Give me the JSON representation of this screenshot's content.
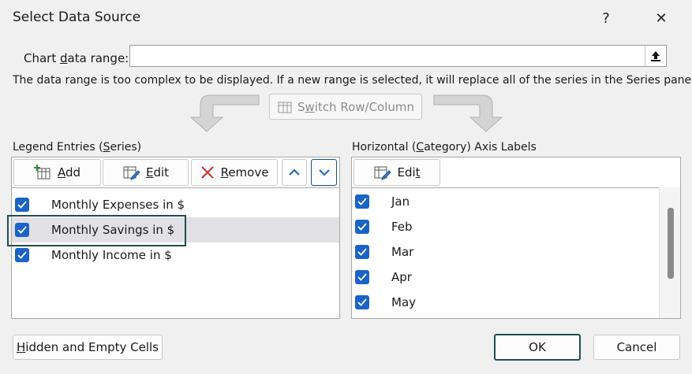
{
  "dialog": {
    "title": "Select Data Source",
    "help_label": "?",
    "close_label": "✕"
  },
  "chart_range": {
    "label_pre": "Chart ",
    "label_u": "d",
    "label_post": "ata range:",
    "value": "",
    "info": "The data range is too complex to be displayed. If a new range is selected, it will replace all of the series in the Series panel."
  },
  "switch_button": {
    "pre": "S",
    "u": "w",
    "post": "itch Row/Column"
  },
  "legend": {
    "label_pre": "Legend Entries (",
    "label_u": "S",
    "label_post": "eries)",
    "add": {
      "u": "A",
      "rest": "dd"
    },
    "edit": {
      "u": "E",
      "rest": "dit"
    },
    "remove": {
      "u": "R",
      "rest": "emove"
    },
    "series": [
      {
        "name": "Monthly Expenses in $",
        "checked": true
      },
      {
        "name": "Monthly Savings in $",
        "checked": true,
        "selected": true
      },
      {
        "name": "Monthly Income in $",
        "checked": true
      }
    ]
  },
  "axis": {
    "label_pre": "Horizontal (",
    "label_u": "C",
    "label_post": "ategory) Axis Labels",
    "edit": {
      "pre": "Edi",
      "u": "t"
    },
    "labels": [
      {
        "name": "Jan",
        "checked": true
      },
      {
        "name": "Feb",
        "checked": true
      },
      {
        "name": "Mar",
        "checked": true
      },
      {
        "name": "Apr",
        "checked": true
      },
      {
        "name": "May",
        "checked": true
      }
    ]
  },
  "footer": {
    "hidden_u": "H",
    "hidden_rest": "idden and Empty Cells",
    "ok": "OK",
    "cancel": "Cancel"
  },
  "colors": {
    "checkbox": "#1a63c7",
    "focus": "#1f4e4e",
    "remove_x": "#d22f2f"
  }
}
